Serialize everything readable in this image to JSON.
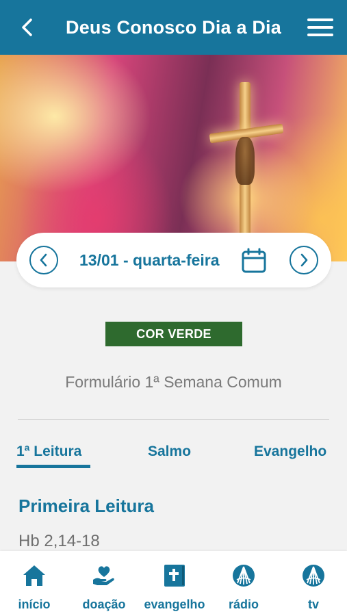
{
  "header": {
    "title": "Deus Conosco Dia a Dia",
    "back_icon": "arrow-left-icon",
    "menu_icon": "hamburger-menu-icon"
  },
  "hero": {
    "image": "crucifix-with-colorful-light"
  },
  "date_nav": {
    "date_label": "13/01 - quarta-feira",
    "prev_icon": "chevron-left-icon",
    "next_icon": "chevron-right-icon",
    "calendar_icon": "calendar-icon"
  },
  "liturgical_color": {
    "label": "COR VERDE",
    "color": "#2e6a2e"
  },
  "formulario": "Formulário 1ª Semana Comum",
  "tabs": [
    {
      "label": "1ª Leitura",
      "active": true
    },
    {
      "label": "Salmo",
      "active": false
    },
    {
      "label": "Evangelho",
      "active": false
    }
  ],
  "reading": {
    "title": "Primeira Leitura",
    "reference": "Hb 2,14-18"
  },
  "bottom_nav": [
    {
      "label": "início",
      "icon": "home-icon"
    },
    {
      "label": "doação",
      "icon": "hand-heart-icon"
    },
    {
      "label": "evangelho",
      "icon": "bible-icon"
    },
    {
      "label": "rádio",
      "icon": "radio-logo-icon"
    },
    {
      "label": "tv",
      "icon": "tv-logo-icon"
    }
  ],
  "colors": {
    "primary": "#17759c",
    "background": "#f2f2f2",
    "badge_green": "#2e6a2e"
  }
}
